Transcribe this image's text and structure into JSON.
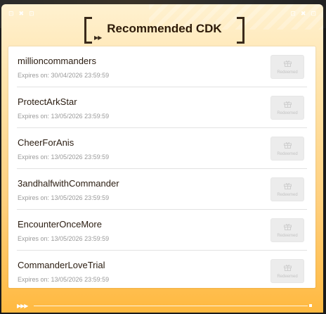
{
  "header": {
    "title": "Recommended CDK",
    "left_icons": [
      "⊡",
      "✖",
      "⊡"
    ],
    "right_icons": [
      "⊡",
      "✖",
      "⊡"
    ]
  },
  "colors": {
    "panel_top": "#fff1d0",
    "panel_bottom": "#ffb940",
    "title_text": "#2d1a08",
    "button_bg": "#ececec",
    "button_text": "#c4c4c4"
  },
  "cdk_list": [
    {
      "code": "millioncommanders",
      "expires": "Expires on: 30/04/2026 23:59:59",
      "button": "Redeemed",
      "icon": "gift-icon"
    },
    {
      "code": "ProtectArkStar",
      "expires": "Expires on: 13/05/2026 23:59:59",
      "button": "Redeemed",
      "icon": "gift-icon"
    },
    {
      "code": "CheerForAnis",
      "expires": "Expires on: 13/05/2026 23:59:59",
      "button": "Redeemed",
      "icon": "gift-icon"
    },
    {
      "code": "3andhalfwithCommander",
      "expires": "Expires on: 13/05/2026 23:59:59",
      "button": "Redeemed",
      "icon": "gift-icon"
    },
    {
      "code": "EncounterOnceMore",
      "expires": "Expires on: 13/05/2026 23:59:59",
      "button": "Redeemed",
      "icon": "gift-icon"
    },
    {
      "code": "CommanderLoveTrial",
      "expires": "Expires on: 13/05/2026 23:59:59",
      "button": "Redeemed",
      "icon": "gift-icon"
    }
  ]
}
